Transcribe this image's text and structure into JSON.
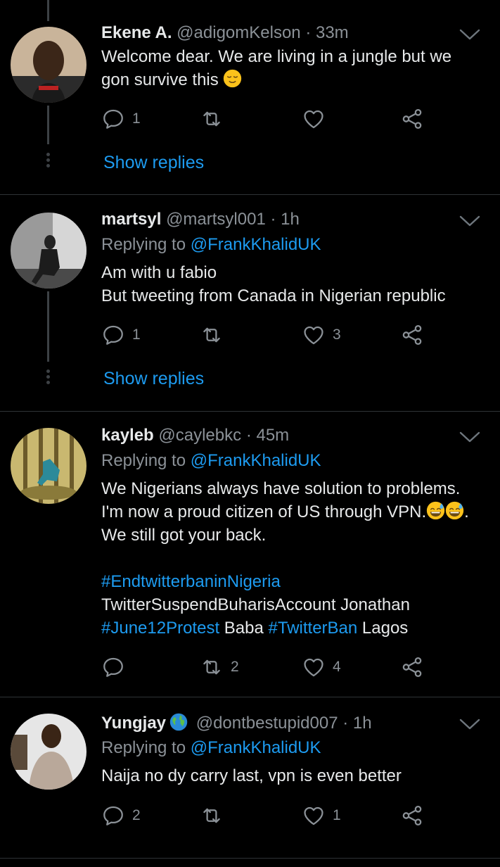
{
  "colors": {
    "background": "#000000",
    "link": "#1d9bf0",
    "muted": "#8b9197",
    "text": "#e7e9ea",
    "divider": "#2f3336"
  },
  "tweets": [
    {
      "name": "Ekene A.",
      "handle": "@adigomKelson",
      "separator": "·",
      "time": "33m",
      "lines": [
        "Welcome dear. We are living in a jungle but we",
        "gon survive this"
      ],
      "emoji": "relieved-face",
      "reply_count": "1",
      "retweet_count": "",
      "like_count": "",
      "show_replies": "Show replies"
    },
    {
      "name": "martsyl",
      "handle": "@martsyl001",
      "separator": "·",
      "time": "1h",
      "replying_prefix": "Replying to",
      "replying_to": "@FrankKhalidUK",
      "lines": [
        "Am with u fabio",
        "But tweeting from Canada in Nigerian republic"
      ],
      "reply_count": "1",
      "retweet_count": "",
      "like_count": "3",
      "show_replies": "Show replies"
    },
    {
      "name": "kayleb",
      "handle": "@caylebkc",
      "separator": "·",
      "time": "45m",
      "replying_prefix": "Replying to",
      "replying_to": "@FrankKhalidUK",
      "lines": [
        "We Nigerians always have solution to problems.",
        "I'm now a proud citizen of US through VPN.",
        "We still got your back."
      ],
      "line2_suffix": ".",
      "emoji": "grinning-face-with-sweat",
      "hashtag_1": "#EndtwitterbaninNigeria",
      "text_2": "TwitterSuspendBuharisAccount Jonathan",
      "hashtag_2": "#June12Protest",
      "text_3": " Baba ",
      "hashtag_3": "#TwitterBan",
      "text_4": " Lagos",
      "reply_count": "",
      "retweet_count": "2",
      "like_count": "4"
    },
    {
      "name": "Yungjay",
      "badge": "globe-emoji",
      "handle": "@dontbestupid007",
      "separator": "·",
      "time": "1h",
      "replying_prefix": "Replying to",
      "replying_to": "@FrankKhalidUK",
      "lines": [
        "Naija no dy carry last, vpn is even better"
      ],
      "reply_count": "2",
      "retweet_count": "",
      "like_count": "1"
    }
  ]
}
